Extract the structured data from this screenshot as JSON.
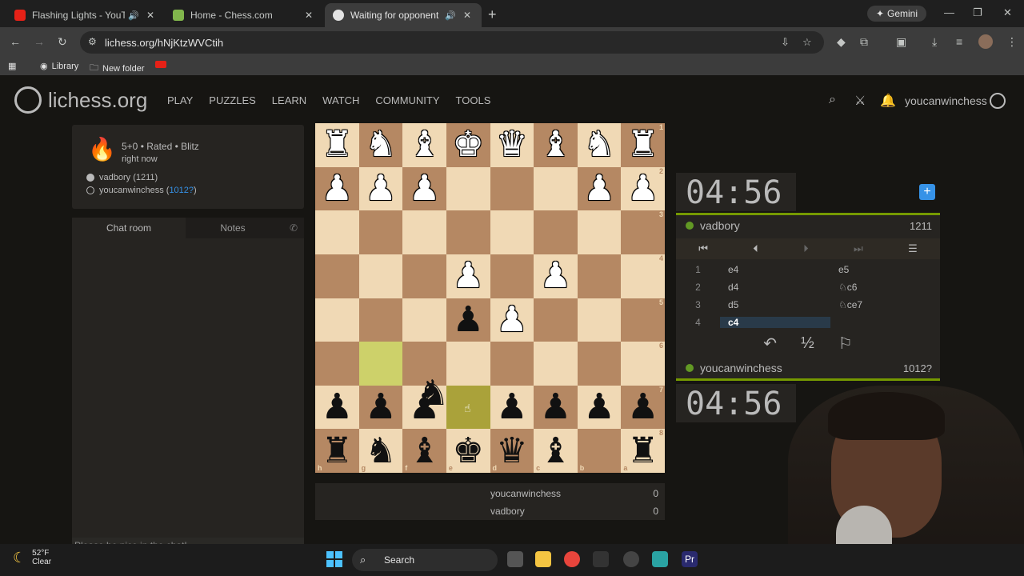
{
  "browser": {
    "tabs": [
      {
        "title": "Flashing Lights - YouTube",
        "active": false
      },
      {
        "title": "Home - Chess.com",
        "active": false
      },
      {
        "title": "Waiting for opponent - Play",
        "active": true
      }
    ],
    "gemini_label": "Gemini",
    "url": "lichess.org/hNjKtzWVCtih",
    "bookmarks": [
      {
        "label": "Library"
      },
      {
        "label": "New folder"
      }
    ]
  },
  "site": {
    "logo_text": "lichess.org",
    "nav": [
      "PLAY",
      "PUZZLES",
      "LEARN",
      "WATCH",
      "COMMUNITY",
      "TOOLS"
    ],
    "username": "youcanwinchess"
  },
  "game": {
    "mode": "5+0 • Rated • Blitz",
    "time_ago": "right now",
    "player_white": "vadbory (1211)",
    "player_black_name": "youcanwinchess (",
    "player_black_rating": "1012?",
    "player_black_close": ")"
  },
  "chat": {
    "tab_chat": "Chat room",
    "tab_notes": "Notes",
    "placeholder": "Please be nice in the chat!"
  },
  "board": {
    "files_bottom": [
      "h",
      "g",
      "f",
      "e",
      "d",
      "c",
      "b",
      "a"
    ],
    "ranks_right": [
      "1",
      "2",
      "3",
      "4",
      "5",
      "6",
      "7",
      "8"
    ],
    "rows": [
      [
        "wR",
        "wN",
        "wB",
        "wK",
        "wQ",
        "wB",
        "wN",
        "wR"
      ],
      [
        "wP",
        "wP",
        "wP",
        "",
        "",
        "",
        "wP",
        "wP"
      ],
      [
        "",
        "",
        "",
        "",
        "",
        "",
        "",
        ""
      ],
      [
        "",
        "",
        "",
        "wP",
        "",
        "wP",
        "",
        ""
      ],
      [
        "",
        "",
        "",
        "bP",
        "wP",
        "",
        "",
        ""
      ],
      [
        "",
        "",
        "",
        "",
        "",
        "",
        "",
        ""
      ],
      [
        "bP",
        "bP",
        "bP",
        "",
        "bP",
        "bP",
        "bP",
        "bP"
      ],
      [
        "bR",
        "bN",
        "bB",
        "bK",
        "bQ",
        "bB",
        "",
        "bR"
      ]
    ],
    "highlight": [
      [
        5,
        1
      ],
      [
        6,
        3
      ]
    ]
  },
  "crosstable": {
    "rows": [
      {
        "name": "youcanwinchess",
        "score": "0"
      },
      {
        "name": "vadbory",
        "score": "0"
      }
    ]
  },
  "clocks": {
    "top": "04:56",
    "bottom": "04:56"
  },
  "players": {
    "top": {
      "name": "vadbory",
      "rating": "1211"
    },
    "bottom": {
      "name": "youcanwinchess",
      "rating": "1012?"
    }
  },
  "moves": [
    {
      "num": "1",
      "white": "e4",
      "black": "e5"
    },
    {
      "num": "2",
      "white": "d4",
      "black": "♘c6"
    },
    {
      "num": "3",
      "white": "d5",
      "black": "♘ce7"
    },
    {
      "num": "4",
      "white": "c4",
      "black": ""
    }
  ],
  "taskbar": {
    "temp": "52°F",
    "condition": "Clear",
    "search": "Search"
  }
}
